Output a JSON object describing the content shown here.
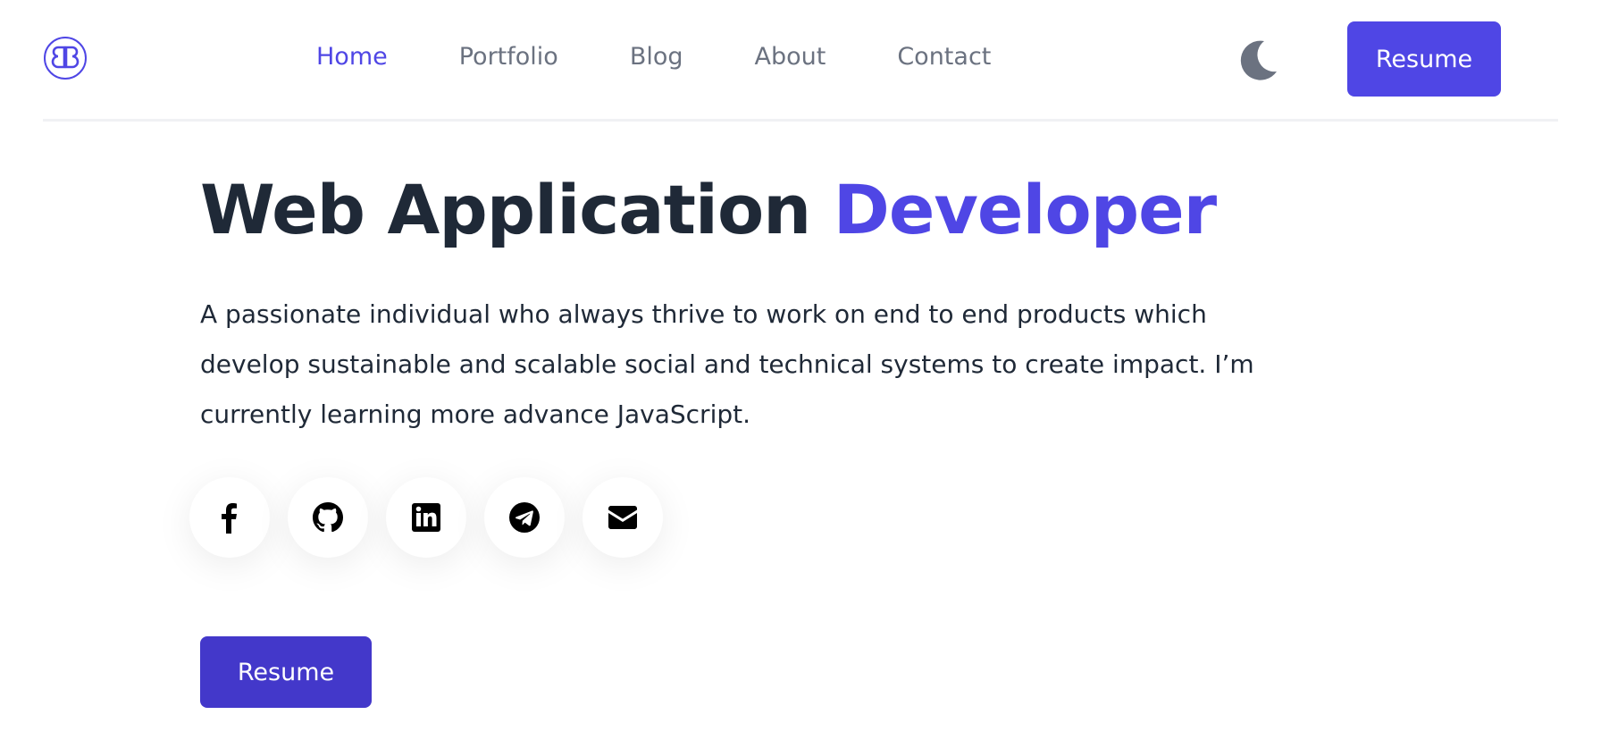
{
  "header": {
    "logo_text": "BB",
    "nav": {
      "home": "Home",
      "portfolio": "Portfolio",
      "blog": "Blog",
      "about": "About",
      "contact": "Contact"
    },
    "active_item": "Home",
    "theme_icon": "moon-icon",
    "resume_label": "Resume"
  },
  "hero": {
    "title_main": "Web Application ",
    "title_accent": "Developer",
    "description": "A passionate individual who always thrive to work on end to end products which develop sustainable and scalable social and technical systems to create impact. I’m currently learning more advance JavaScript.",
    "socials": [
      {
        "name": "facebook-icon"
      },
      {
        "name": "github-icon"
      },
      {
        "name": "linkedin-icon"
      },
      {
        "name": "telegram-icon"
      },
      {
        "name": "email-icon"
      }
    ],
    "resume_label": "Resume"
  },
  "colors": {
    "accent": "#4f46e5",
    "accent_dark": "#4338ca",
    "text_dark": "#1f2937",
    "text_muted": "#6b7280"
  }
}
